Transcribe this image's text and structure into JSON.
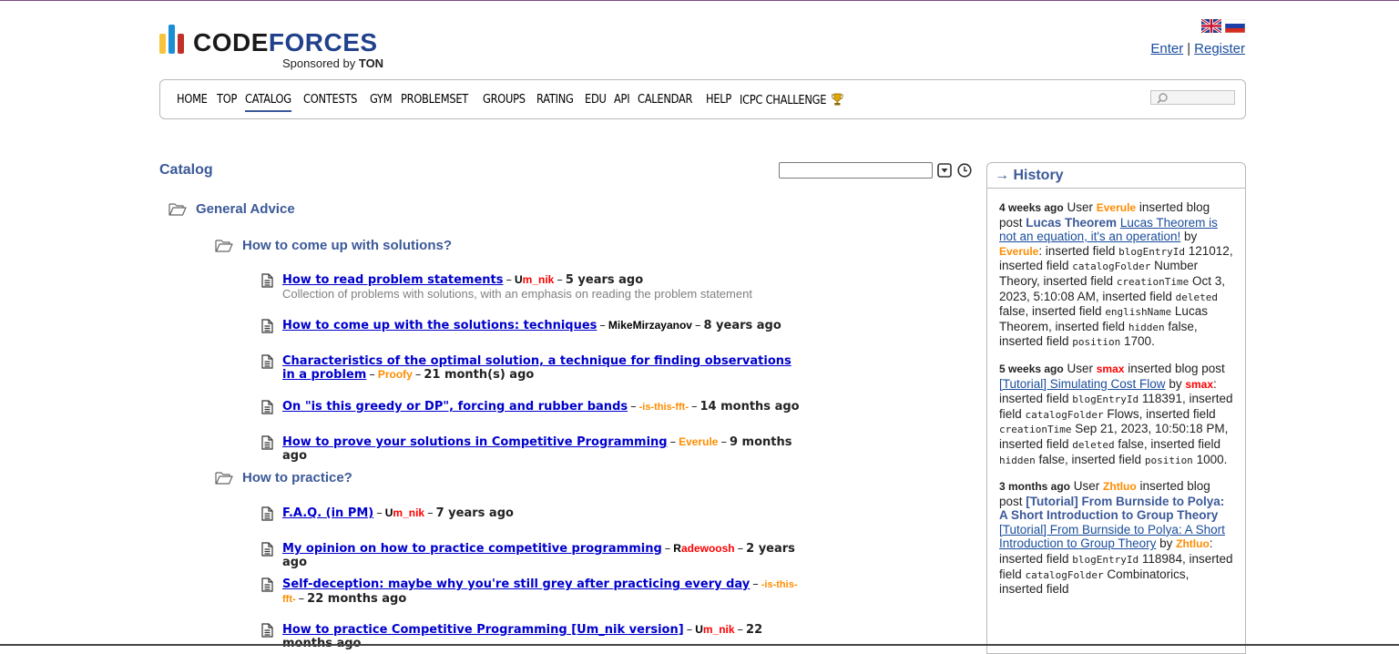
{
  "header": {
    "logo_word_1": "CODE",
    "logo_word_2": "FORCES",
    "sponsor_prefix": "Sponsored by",
    "sponsor_name": "TON",
    "enter": "Enter",
    "separator": "|",
    "register": "Register"
  },
  "menu": {
    "items": [
      "HOME",
      "TOP",
      "CATALOG",
      "CONTESTS",
      "GYM",
      "PROBLEMSET",
      "GROUPS",
      "RATING",
      "EDU",
      "API",
      "CALENDAR",
      "HELP",
      "ICPC CHALLENGE"
    ],
    "active": "CATALOG"
  },
  "catalog": {
    "title": "Catalog",
    "folders": {
      "general": "General Advice",
      "solutions": "How to come up with solutions?",
      "practice": "How to practice?"
    },
    "entries": [
      {
        "title": "How to read problem statements",
        "user": "Um_nik",
        "when": "5 years ago",
        "desc": "Collection of problems with solutions, with an emphasis on reading the problem statement"
      },
      {
        "title": "How to come up with the solutions: techniques",
        "user": "MikeMirzayanov",
        "when": "8 years ago"
      },
      {
        "title": "Characteristics of the optimal solution, a technique for finding observations in a problem",
        "user": "Proofy",
        "when": "21 month(s) ago"
      },
      {
        "title": "On \"is this greedy or DP\", forcing and rubber bands",
        "user": "-is-this-fft-",
        "when": "14 months ago"
      },
      {
        "title": "How to prove your solutions in Competitive Programming",
        "user": "Everule",
        "when": "9 months ago"
      },
      {
        "title": "F.A.Q. (in PM)",
        "user": "Um_nik",
        "when": "7 years ago"
      },
      {
        "title": "My opinion on how to practice competitive programming",
        "user": "Radewoosh",
        "when": "2 years ago"
      },
      {
        "title": "Self-deception: maybe why you're still grey after practicing every day",
        "user": "-is-this-fft-",
        "when": "22 months ago"
      },
      {
        "title": "How to practice Competitive Programming [Um_nik version]",
        "user": "Um_nik",
        "when": "22 months ago"
      }
    ],
    "dash": "–"
  },
  "history": {
    "title": "→ History",
    "items": [
      {
        "ago": "4 weeks ago",
        "p1": " User ",
        "user": "Everule",
        "p2": " inserted blog post ",
        "bold_title": "Lucas Theorem",
        "link": "Lucas Theorem is not an equation, it's an operation!",
        "p3": " by ",
        "p4": ": inserted field ",
        "f1": "blogEntryId",
        "v1": " 121012, inserted field ",
        "f2": "catalogFolder",
        "v2": " Number Theory, inserted field ",
        "f3": "creationTime",
        "v3": " Oct 3, 2023, 5:10:08 AM, inserted field ",
        "f4": "deleted",
        "v4": " false, inserted field ",
        "f5": "englishName",
        "v5": " Lucas Theorem, inserted field ",
        "f6": "hidden",
        "v6": " false, inserted field ",
        "f7": "position",
        "v7": " 1700."
      },
      {
        "ago": "5 weeks ago",
        "p1": " User ",
        "user": "smax",
        "p2": " inserted blog post ",
        "link": "[Tutorial] Simulating Cost Flow",
        "p3": " by ",
        "p4": ": inserted field ",
        "f1": "blogEntryId",
        "v1": " 118391, inserted field ",
        "f2": "catalogFolder",
        "v2": " Flows, inserted field ",
        "f3": "creationTime",
        "v3": " Sep 21, 2023, 10:50:18 PM, inserted field ",
        "f4": "deleted",
        "v4": " false, inserted field ",
        "f5": "hidden",
        "v5": " false, inserted field ",
        "f6": "position",
        "v6": " 1000."
      },
      {
        "ago": "3 months ago",
        "p1": " User ",
        "user": "Zhtluo",
        "p2": " inserted blog post ",
        "bold_title": "[Tutorial] From Burnside to Polya: A Short Introduction to Group Theory",
        "link": "[Tutorial] From Burnside to Polya: A Short Introduction to Group Theory",
        "p3": " by ",
        "p4": ": inserted field ",
        "f1": "blogEntryId",
        "v1": " 118984, inserted field ",
        "f2": "catalogFolder",
        "v2": " Combinatorics, inserted field"
      }
    ]
  },
  "colors": {
    "brand_blue": "#3b5998",
    "link_blue": "#0000cc",
    "red_user": "#ff0000",
    "orange_user": "#ff8c00"
  }
}
